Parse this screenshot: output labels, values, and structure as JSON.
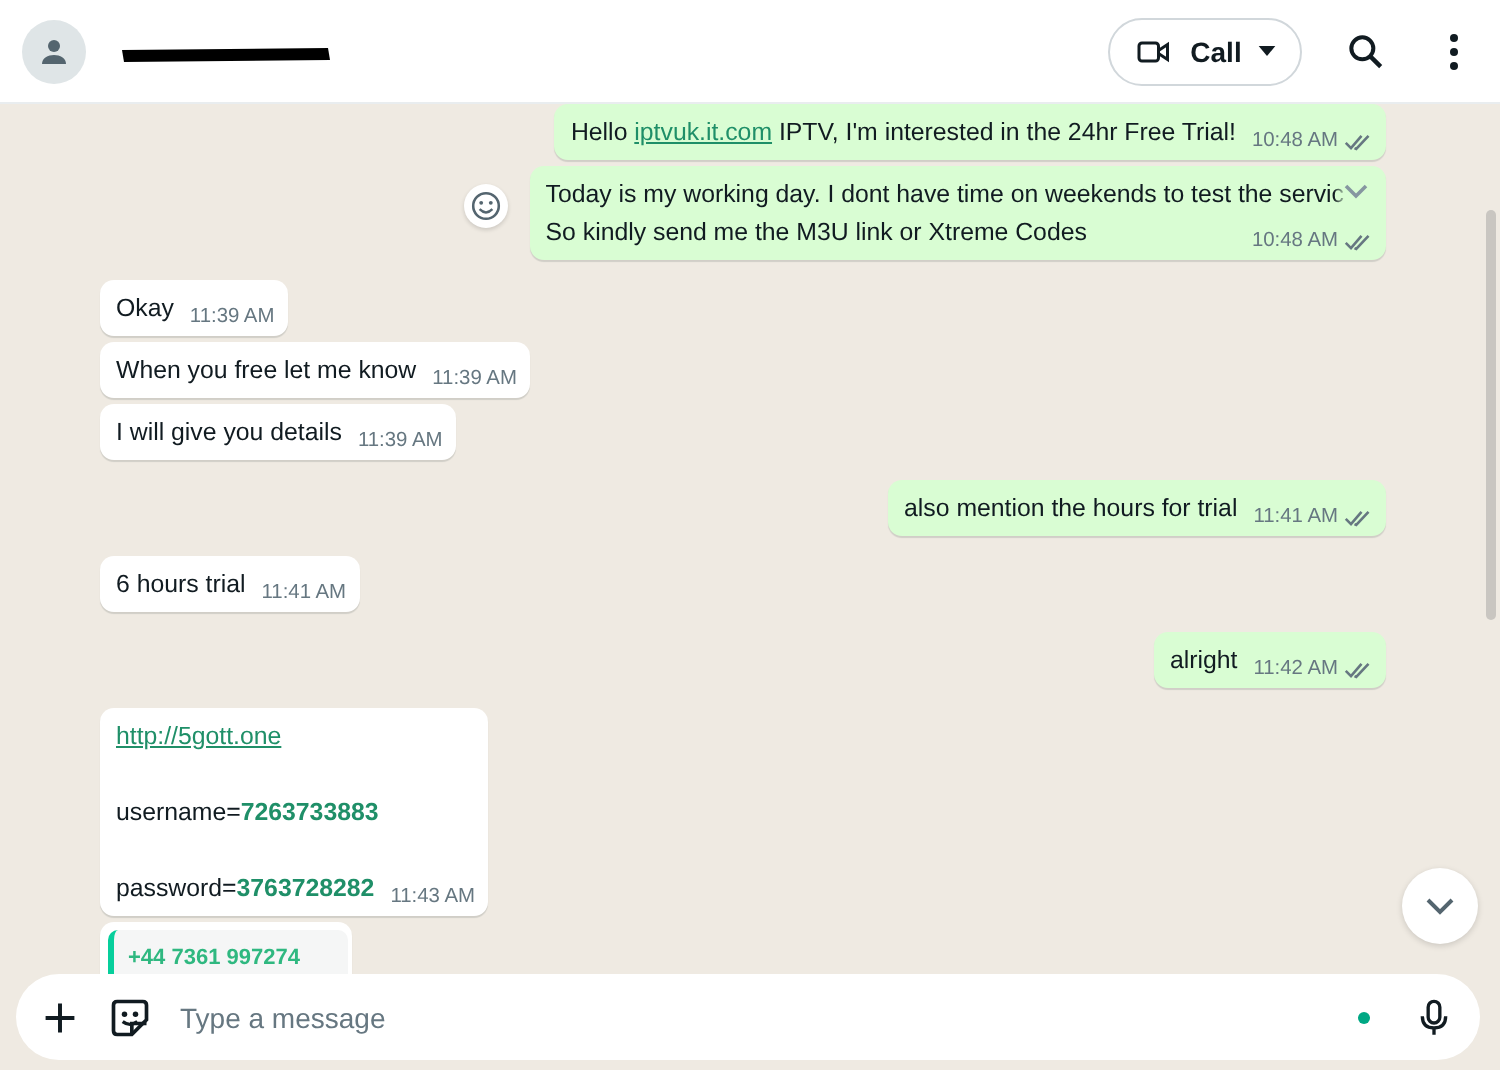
{
  "header": {
    "call_button": {
      "label": "Call"
    }
  },
  "messages": [
    {
      "outgoing": true,
      "kind": "text",
      "hovered": false,
      "lines": [
        [
          {
            "kind": "text",
            "text": "Hello "
          },
          {
            "kind": "link",
            "text": "iptvuk.it.com"
          },
          {
            "kind": "text",
            "text": " IPTV, I'm interested in the 24hr Free Trial!"
          }
        ]
      ],
      "time": "10:48 AM",
      "double_tick": true
    },
    {
      "outgoing": true,
      "kind": "text",
      "hovered": true,
      "lines": [
        [
          {
            "kind": "text",
            "text": "Today is my working day. I dont have time on weekends to test the servic"
          }
        ],
        [
          {
            "kind": "text",
            "text": "So kindly send me the M3U link or Xtreme Codes"
          }
        ]
      ],
      "time": "10:48 AM",
      "double_tick": true
    },
    {
      "outgoing": false,
      "kind": "text",
      "hovered": false,
      "lines": [
        [
          {
            "kind": "text",
            "text": "Okay"
          }
        ]
      ],
      "time": "11:39 AM"
    },
    {
      "outgoing": false,
      "kind": "text",
      "hovered": false,
      "lines": [
        [
          {
            "kind": "text",
            "text": "When you free let me know"
          }
        ]
      ],
      "time": "11:39 AM"
    },
    {
      "outgoing": false,
      "kind": "text",
      "hovered": false,
      "lines": [
        [
          {
            "kind": "text",
            "text": "I will give you details"
          }
        ]
      ],
      "time": "11:39 AM"
    },
    {
      "outgoing": true,
      "kind": "text",
      "hovered": false,
      "lines": [
        [
          {
            "kind": "text",
            "text": "also mention the hours for trial"
          }
        ]
      ],
      "time": "11:41 AM",
      "double_tick": true
    },
    {
      "outgoing": false,
      "kind": "text",
      "hovered": false,
      "lines": [
        [
          {
            "kind": "text",
            "text": "6 hours trial"
          }
        ]
      ],
      "time": "11:41 AM"
    },
    {
      "outgoing": true,
      "kind": "text",
      "hovered": false,
      "lines": [
        [
          {
            "kind": "text",
            "text": "alright"
          }
        ]
      ],
      "time": "11:42 AM",
      "double_tick": true
    },
    {
      "outgoing": false,
      "kind": "spaced",
      "hovered": false,
      "lines": [
        [
          {
            "kind": "link",
            "text": "http://5gott.one"
          }
        ],
        [
          {
            "kind": "text",
            "text": "username="
          },
          {
            "kind": "number",
            "text": "7263733883"
          }
        ],
        [
          {
            "kind": "text",
            "text": "password="
          },
          {
            "kind": "number",
            "text": "3763728282"
          }
        ]
      ],
      "time": "11:43 AM"
    },
    {
      "outgoing": false,
      "kind": "quote",
      "sender": "+44 7361 997274"
    }
  ],
  "composer": {
    "placeholder": "Type a message"
  }
}
